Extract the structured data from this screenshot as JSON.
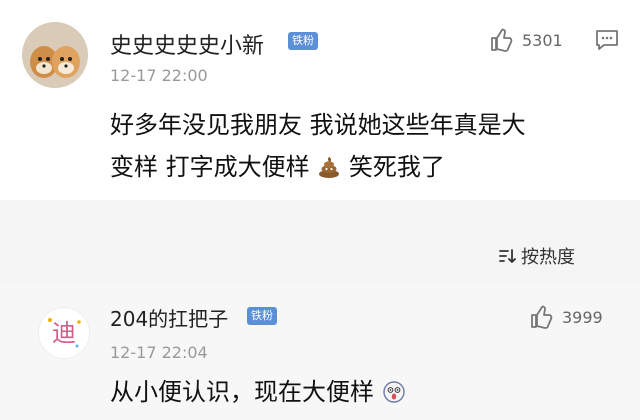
{
  "comments": [
    {
      "username": "史史史史史小新",
      "badge": "铁粉",
      "time": "12-17 22:00",
      "text_line1": "好多年没见我朋友 我说她这些年真是大",
      "text_line2": "变样 打字成大便样",
      "text_line2_tail": "笑死我了",
      "inline_icon": "poop-emoji",
      "likes": "5301",
      "icons": [
        "shiba-avatar",
        "thumbs-up-icon",
        "reply-icon"
      ]
    },
    {
      "username": "204的扛把子",
      "badge": "铁粉",
      "time": "12-17 22:04",
      "text": "从小便认识，现在大便样",
      "inline_icon": "surprised-face-emoji",
      "likes": "3999",
      "avatar_text": "迪",
      "icons": [
        "thumbs-up-icon"
      ]
    }
  ],
  "sort": {
    "label": "按热度",
    "icon": "sort-icon"
  }
}
